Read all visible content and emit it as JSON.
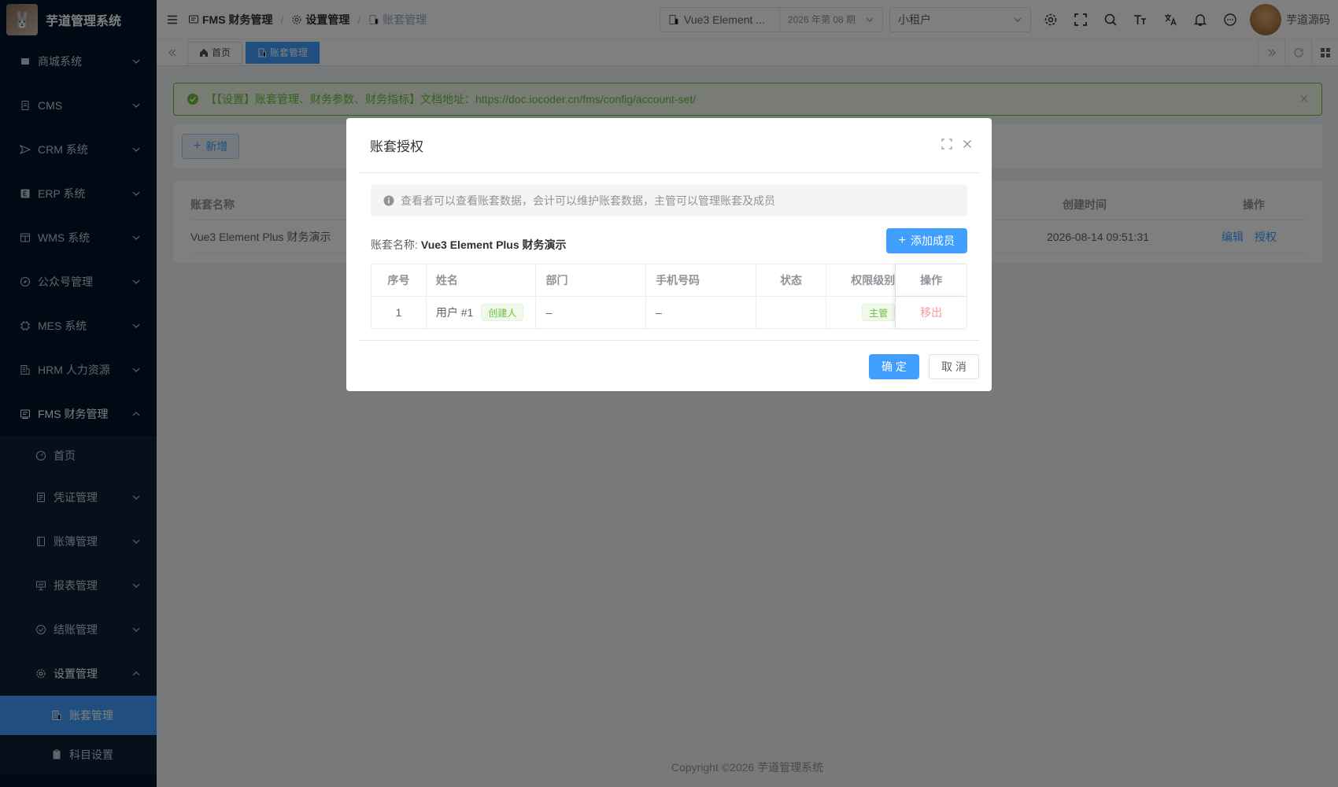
{
  "app": {
    "title": "芋道管理系统"
  },
  "sidebar": {
    "items": [
      {
        "label": "商城系统"
      },
      {
        "label": "CMS"
      },
      {
        "label": "CRM 系统"
      },
      {
        "label": "ERP 系统"
      },
      {
        "label": "WMS 系统"
      },
      {
        "label": "公众号管理"
      },
      {
        "label": "MES 系统"
      },
      {
        "label": "HRM 人力资源"
      },
      {
        "label": "FMS 财务管理"
      }
    ],
    "fms_children": [
      {
        "label": "首页"
      },
      {
        "label": "凭证管理"
      },
      {
        "label": "账簿管理"
      },
      {
        "label": "报表管理"
      },
      {
        "label": "结账管理"
      },
      {
        "label": "设置管理"
      }
    ],
    "settings_children": [
      {
        "label": "账套管理"
      },
      {
        "label": "科目设置"
      }
    ]
  },
  "header": {
    "breadcrumb": [
      "FMS 财务管理",
      "设置管理",
      "账套管理"
    ],
    "account_set": "Vue3 Element ...",
    "period": "2026 年第 08 期",
    "tenant": "小租户",
    "user_name": "芋道源码"
  },
  "tags": {
    "home": "首页",
    "current": "账套管理"
  },
  "alert": {
    "text": "【【设置】账套管理、财务参数、财务指标】文档地址：https://doc.iocoder.cn/fms/config/account-set/"
  },
  "toolbar": {
    "add_label": "新增"
  },
  "list": {
    "headers": {
      "name": "账套名称",
      "created": "创建时间",
      "actions": "操作"
    },
    "row": {
      "name": "Vue3 Element Plus 财务演示",
      "created": "2026-08-14 09:51:31",
      "edit": "编辑",
      "auth": "授权"
    }
  },
  "dialog": {
    "title": "账套授权",
    "info": "查看者可以查看账套数据，会计可以维护账套数据，主管可以管理账套及成员",
    "account_label": "账套名称:",
    "account_value": "Vue3 Element Plus 财务演示",
    "add_member": "添加成员",
    "columns": [
      "序号",
      "姓名",
      "部门",
      "手机号码",
      "状态",
      "权限级别",
      "操作"
    ],
    "rows": [
      {
        "index": "1",
        "name": "用户 #1",
        "creator_tag": "创建人",
        "dept": "–",
        "phone": "–",
        "status": "",
        "role": "主管",
        "action": "移出"
      }
    ],
    "ok": "确 定",
    "cancel": "取 消"
  },
  "footer": {
    "copyright": "Copyright ©2026 芋道管理系统"
  }
}
